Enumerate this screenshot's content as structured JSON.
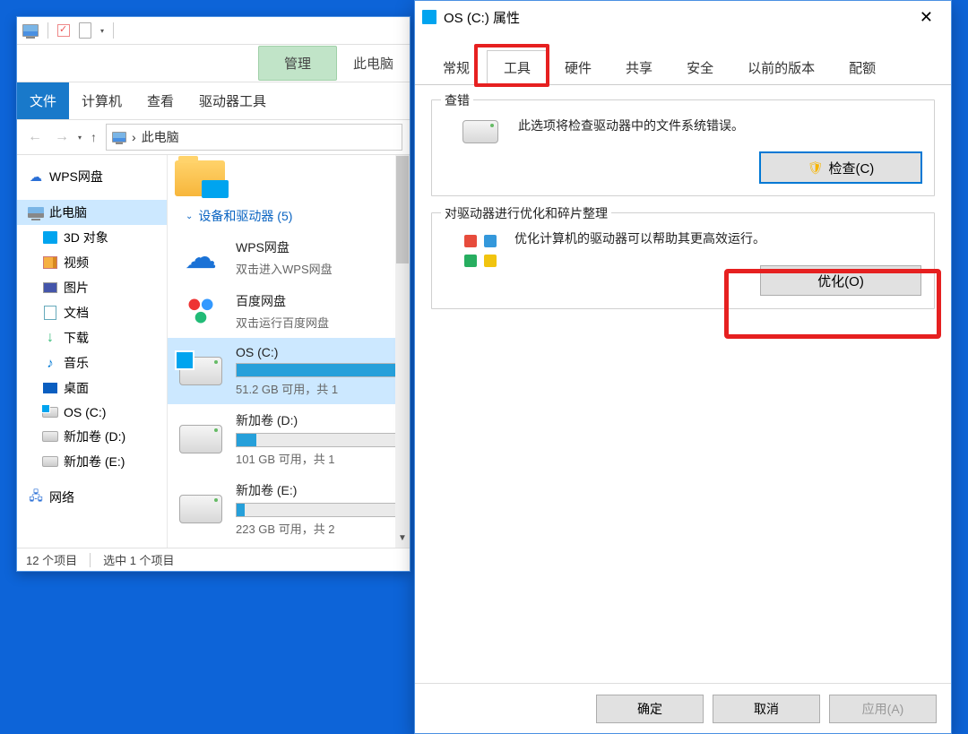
{
  "explorer": {
    "ribbon": {
      "file": "文件",
      "computer": "计算机",
      "view": "查看",
      "manage": "管理",
      "drive_tools": "驱动器工具",
      "context_title": "此电脑"
    },
    "address": "此电脑",
    "tree": {
      "wps": "WPS网盘",
      "this_pc": "此电脑",
      "obj3d": "3D 对象",
      "video": "视频",
      "pictures": "图片",
      "documents": "文档",
      "downloads": "下载",
      "music": "音乐",
      "desktop": "桌面",
      "os_c": "OS (C:)",
      "vol_d": "新加卷 (D:)",
      "vol_e": "新加卷 (E:)",
      "network": "网络"
    },
    "content": {
      "group_header": "设备和驱动器 (5)",
      "wps": {
        "name": "WPS网盘",
        "sub": "双击进入WPS网盘"
      },
      "baidu": {
        "name": "百度网盘",
        "sub": "双击运行百度网盘"
      },
      "os": {
        "name": "OS (C:)",
        "sub": "51.2 GB 可用，共 1"
      },
      "d": {
        "name": "新加卷 (D:)",
        "sub": "101 GB 可用，共 1"
      },
      "e": {
        "name": "新加卷 (E:)",
        "sub": "223 GB 可用，共 2"
      }
    },
    "status": {
      "items": "12 个项目",
      "selected": "选中 1 个项目"
    }
  },
  "dialog": {
    "title": "OS (C:) 属性",
    "tabs": {
      "general": "常规",
      "tools": "工具",
      "hardware": "硬件",
      "sharing": "共享",
      "security": "安全",
      "previous": "以前的版本",
      "quota": "配额"
    },
    "check": {
      "title": "查错",
      "desc": "此选项将检查驱动器中的文件系统错误。",
      "btn": "检查(C)"
    },
    "optimize": {
      "title": "对驱动器进行优化和碎片整理",
      "desc": "优化计算机的驱动器可以帮助其更高效运行。",
      "btn": "优化(O)"
    },
    "footer": {
      "ok": "确定",
      "cancel": "取消",
      "apply": "应用(A)"
    }
  }
}
